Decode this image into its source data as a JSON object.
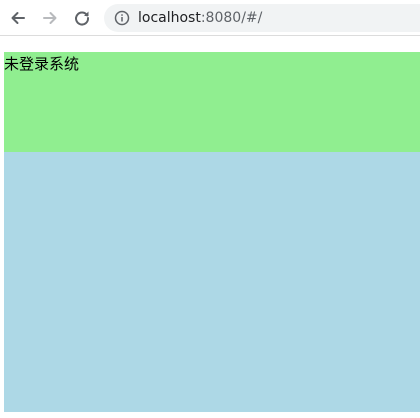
{
  "browser": {
    "url_host": "localhost",
    "url_rest": ":8080/#/",
    "icons": {
      "back": "arrow-left-icon",
      "forward": "arrow-right-icon",
      "reload": "reload-icon",
      "info": "info-icon"
    }
  },
  "page": {
    "status_text": "未登录系统",
    "colors": {
      "header_bg": "#90ee90",
      "content_bg": "#add8e6"
    }
  }
}
